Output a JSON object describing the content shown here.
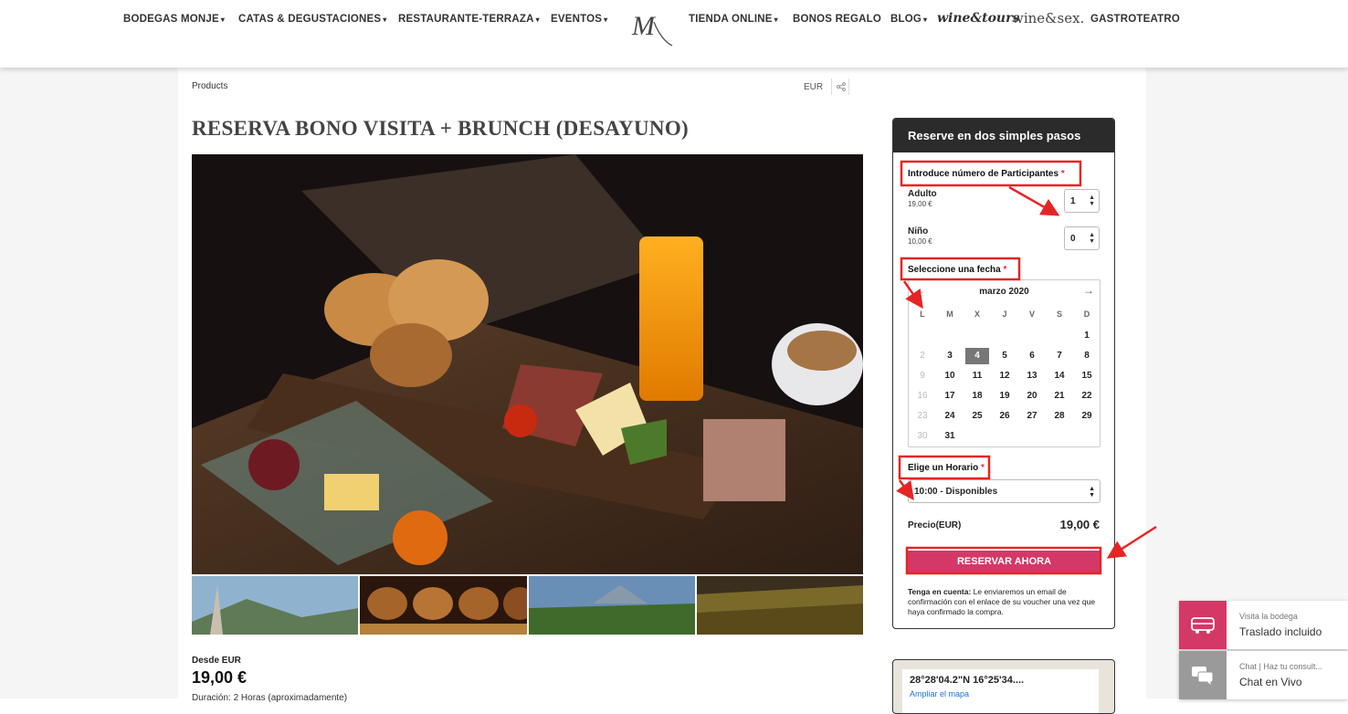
{
  "nav": {
    "items": [
      {
        "label": "BODEGAS MONJE",
        "dropdown": true
      },
      {
        "label": "CATAS & DEGUSTACIONES",
        "dropdown": true
      },
      {
        "label": "RESTAURANTE-TERRAZA",
        "dropdown": true
      },
      {
        "label": "EVENTOS",
        "dropdown": true
      },
      {
        "label": "TIENDA ONLINE",
        "dropdown": true
      },
      {
        "label": "BONOS REGALO",
        "dropdown": false
      },
      {
        "label": "BLOG",
        "dropdown": true
      },
      {
        "label": "GASTROTEATRO",
        "dropdown": false
      }
    ],
    "brand_wine_tours": "wine&tours",
    "brand_wine_sex": "wine&sex.",
    "logo_letter": "M"
  },
  "breadcrumb": "Products",
  "currency": "EUR",
  "product": {
    "title": "RESERVA BONO VISITA + BRUNCH (DESAYUNO)",
    "price_label": "Desde EUR",
    "price_value": "19,00 €",
    "duration": "Duración: 2 Horas (aproximadamente)"
  },
  "booking": {
    "heading": "Reserve en dos simples pasos",
    "participants_label": "Introduce número de Participantes",
    "required_mark": "*",
    "adult_label": "Adulto",
    "adult_price": "19,00 €",
    "adult_qty": "1",
    "child_label": "Niño",
    "child_price": "10,00 €",
    "child_qty": "0",
    "date_label": "Seleccione una fecha",
    "calendar": {
      "month": "marzo 2020",
      "weekdays": [
        "L",
        "M",
        "X",
        "J",
        "V",
        "S",
        "D"
      ],
      "selected_day": "4",
      "rows": [
        [
          "",
          "",
          "",
          "",
          "",
          "",
          "1"
        ],
        [
          "2",
          "3",
          "4",
          "5",
          "6",
          "7",
          "8"
        ],
        [
          "9",
          "10",
          "11",
          "12",
          "13",
          "14",
          "15"
        ],
        [
          "16",
          "17",
          "18",
          "19",
          "20",
          "21",
          "22"
        ],
        [
          "23",
          "24",
          "25",
          "26",
          "27",
          "28",
          "29"
        ],
        [
          "30",
          "31",
          "",
          "",
          "",
          "",
          ""
        ]
      ]
    },
    "time_label": "Elige un Horario",
    "time_value": "10:00 - Disponibles",
    "price_row_label": "Precio(EUR)",
    "price_row_value": "19,00 €",
    "cta": "RESERVAR AHORA",
    "note_bold": "Tenga en cuenta:",
    "note_text": " Le enviaremos un email de confirmación con el enlace de su voucher una vez que haya confirmado la compra."
  },
  "map": {
    "coords": "28°28'04.2\"N 16°25'34....",
    "link": "Ampliar el mapa"
  },
  "widgets": [
    {
      "small": "Visita la bodega",
      "main": "Traslado incluido",
      "color": "#d43867"
    },
    {
      "small": "Chat | Haz tu consult...",
      "main": "Chat en Vivo",
      "color": "#9a9a9a"
    }
  ]
}
